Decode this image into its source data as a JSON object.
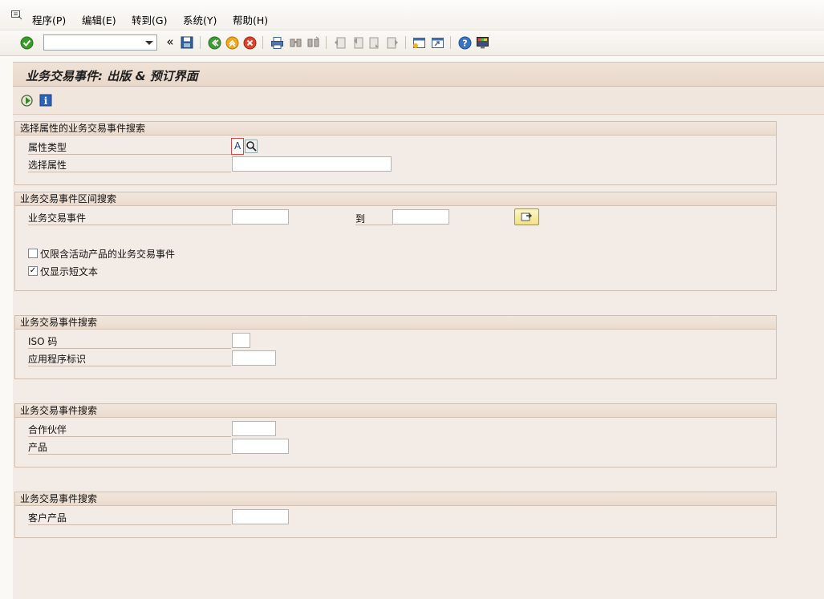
{
  "menu": {
    "items": [
      "程序(P)",
      "编辑(E)",
      "转到(G)",
      "系统(Y)",
      "帮助(H)"
    ]
  },
  "toolbar": {
    "command_field_value": "",
    "icons": [
      "enter-icon",
      "save-icon",
      "back-icon",
      "exit-icon",
      "cancel-icon",
      "print-icon",
      "find-icon",
      "find-next-icon",
      "first-page-icon",
      "prev-page-icon",
      "next-page-icon",
      "last-page-icon",
      "new-session-icon",
      "shortcut-icon",
      "help-icon",
      "customize-layout-icon"
    ]
  },
  "title": "业务交易事件: 出版 & 预订界面",
  "app_toolbar": {
    "icons": [
      "execute-icon",
      "info-icon"
    ]
  },
  "groups": {
    "attr": {
      "header": "选择属性的业务交易事件搜索",
      "attr_type_label": "属性类型",
      "attr_type_value": "A",
      "select_attr_label": "选择属性",
      "select_attr_value": ""
    },
    "interval": {
      "header": "业务交易事件区间搜索",
      "event_label": "业务交易事件",
      "to_label": "到",
      "from_value": "",
      "to_value": "",
      "cb_active_label": "仅限含活动产品的业务交易事件",
      "cb_active_checked": false,
      "cb_short_label": "仅显示短文本",
      "cb_short_checked": true
    },
    "iso": {
      "header": "业务交易事件搜索",
      "iso_label": "ISO 码",
      "app_label": "应用程序标识",
      "iso_value": "",
      "app_value": ""
    },
    "partner": {
      "header": "业务交易事件搜索",
      "partner_label": "合作伙伴",
      "product_label": "产品",
      "partner_value": "",
      "product_value": ""
    },
    "customer": {
      "header": "业务交易事件搜索",
      "customer_product_label": "客户产品",
      "customer_product_value": ""
    }
  }
}
